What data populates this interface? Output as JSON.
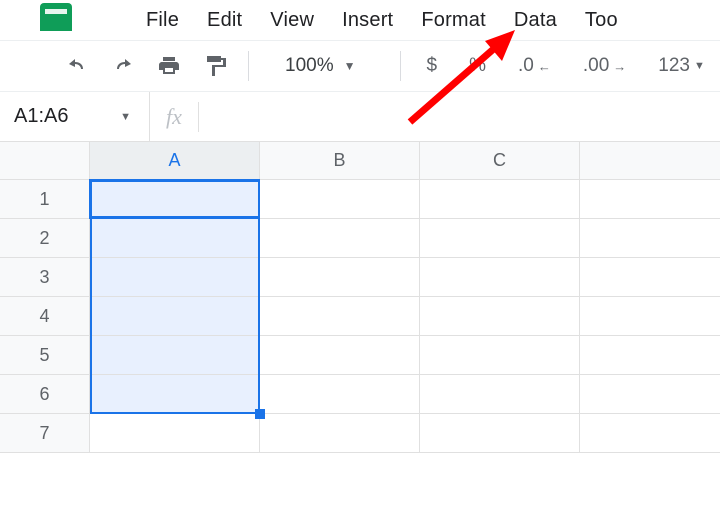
{
  "menu": {
    "items": [
      "File",
      "Edit",
      "View",
      "Insert",
      "Format",
      "Data",
      "Too"
    ]
  },
  "toolbar": {
    "zoom": "100%",
    "fmt_currency": "$",
    "fmt_percent": "%",
    "fmt_dec_dec": ".0",
    "fmt_inc_dec": ".00",
    "fmt_123": "123"
  },
  "namebox": {
    "value": "A1:A6"
  },
  "fx": {
    "label": "fx",
    "value": ""
  },
  "grid": {
    "columns": [
      "A",
      "B",
      "C",
      ""
    ],
    "rows": [
      "1",
      "2",
      "3",
      "4",
      "5",
      "6",
      "7"
    ],
    "selected_column": "A",
    "active_cell": "A1",
    "selection": "A1:A6"
  }
}
